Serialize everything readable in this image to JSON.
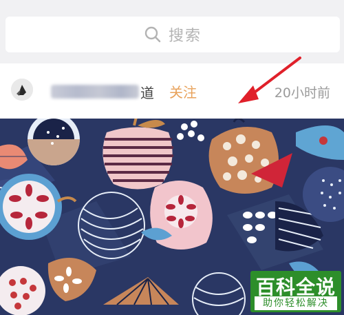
{
  "search": {
    "placeholder": "搜索",
    "icon": "search-icon"
  },
  "post": {
    "author_visible_suffix": "道",
    "follow_label": "关注",
    "time": "20小时前"
  },
  "watermark": {
    "title": "百科全说",
    "subtitle": "助你轻松解决"
  },
  "colors": {
    "follow": "#e8a25b",
    "arrow": "#e0202a",
    "artwork_background": "#2a3764",
    "watermark_green": "#2d8e2a"
  }
}
